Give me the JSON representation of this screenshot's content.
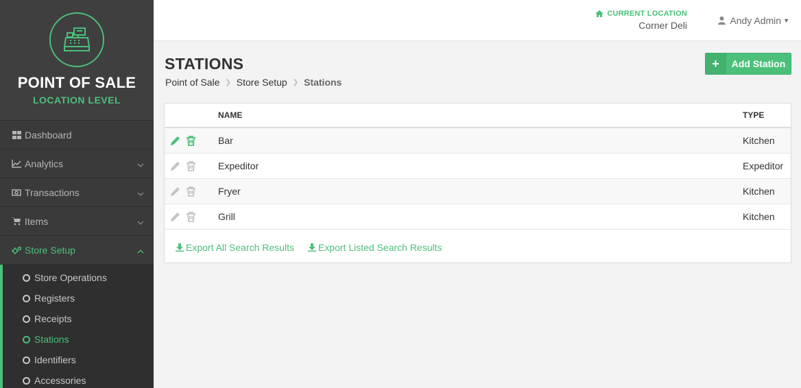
{
  "brand": {
    "title": "POINT OF SALE",
    "subtitle": "LOCATION LEVEL",
    "logo_icon": "cash-register-icon"
  },
  "sidebar": {
    "items": [
      {
        "label": "Dashboard",
        "icon": "grid-icon"
      },
      {
        "label": "Analytics",
        "icon": "line-chart-icon"
      },
      {
        "label": "Transactions",
        "icon": "money-icon"
      },
      {
        "label": "Items",
        "icon": "cart-icon"
      },
      {
        "label": "Store Setup",
        "icon": "gears-icon"
      }
    ],
    "store_setup_children": [
      {
        "label": "Store Operations"
      },
      {
        "label": "Registers"
      },
      {
        "label": "Receipts"
      },
      {
        "label": "Stations"
      },
      {
        "label": "Identifiers"
      },
      {
        "label": "Accessories"
      }
    ]
  },
  "header": {
    "location_label": "CURRENT LOCATION",
    "location_value": "Corner Deli",
    "user_name": "Andy Admin"
  },
  "page": {
    "title": "STATIONS",
    "breadcrumb": [
      "Point of Sale",
      "Store Setup",
      "Stations"
    ],
    "add_button": "Add Station"
  },
  "table": {
    "columns": [
      "NAME",
      "TYPE"
    ],
    "rows": [
      {
        "name": "Bar",
        "type": "Kitchen"
      },
      {
        "name": "Expeditor",
        "type": "Expeditor"
      },
      {
        "name": "Fryer",
        "type": "Kitchen"
      },
      {
        "name": "Grill",
        "type": "Kitchen"
      }
    ]
  },
  "exports": {
    "all": "Export All Search Results",
    "listed": "Export Listed Search Results"
  },
  "colors": {
    "accent": "#4cc07a",
    "sidebar_bg": "#3a3a3a",
    "muted_icon": "#c4c4c4"
  }
}
